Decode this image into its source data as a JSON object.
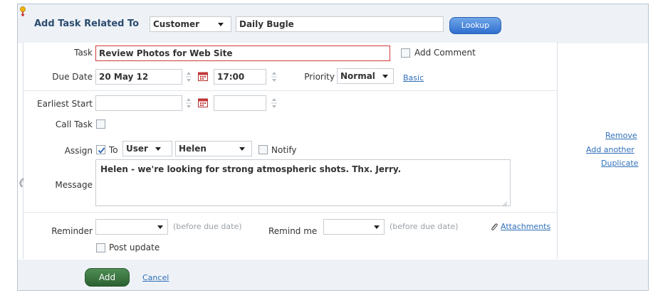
{
  "header": {
    "title": "Add Task Related To",
    "related_type": "Customer",
    "related_name": "Daily Bugle",
    "lookup_label": "Lookup"
  },
  "task": {
    "label": "Task",
    "value": "Review Photos for Web Site",
    "add_comment_label": "Add Comment"
  },
  "due": {
    "label": "Due Date",
    "date": "20 May 12",
    "time": "17:00",
    "priority_label": "Priority",
    "priority_value": "Normal",
    "basic_link": "Basic"
  },
  "earliest": {
    "label": "Earliest Start",
    "date": "",
    "time": ""
  },
  "call_task": {
    "label": "Call Task",
    "checked": false
  },
  "assign": {
    "label": "Assign",
    "checked": true,
    "to_label": "To",
    "type_value": "User",
    "user_value": "Helen",
    "notify_label": "Notify"
  },
  "message": {
    "label": "Message",
    "text": "Helen - we're looking for strong atmospheric shots. Thx. Jerry."
  },
  "reminder": {
    "label": "Reminder",
    "value": "",
    "hint": "(before due date)",
    "remind_me_label": "Remind me",
    "remind_me_value": "",
    "remind_me_hint": "(before due date)",
    "attachments_label": "Attachments"
  },
  "post_update": {
    "label": "Post update",
    "checked": false
  },
  "side_links": {
    "remove": "Remove",
    "add_another": "Add another",
    "duplicate": "Duplicate"
  },
  "footer": {
    "add_label": "Add",
    "cancel_label": "Cancel"
  },
  "colors": {
    "accent_blue": "#2f6fd0",
    "link_blue": "#2f6fb8",
    "add_green": "#2c6132",
    "task_border_red": "#d13a3a"
  }
}
